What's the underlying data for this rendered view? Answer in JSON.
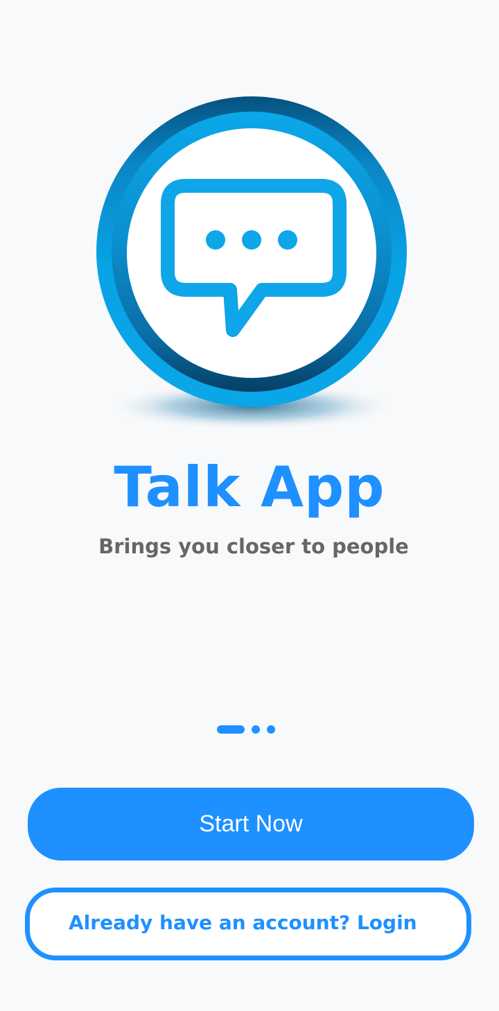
{
  "logo": {
    "icon": "chat-bubble-icon",
    "colors": {
      "ring_dark": "#075a8c",
      "ring_mid": "#0a7fc0",
      "ring_light": "#08a3e6",
      "bubble": "#0ea5e9"
    }
  },
  "app": {
    "title": "Talk App",
    "tagline": "Brings you closer to people"
  },
  "pager": {
    "pages": 3,
    "active_index": 0
  },
  "actions": {
    "start_label": "Start Now",
    "login_label": "Already have an account? Login"
  },
  "colors": {
    "accent": "#1e90ff",
    "background": "#f8f9fa",
    "tagline": "#666666"
  }
}
